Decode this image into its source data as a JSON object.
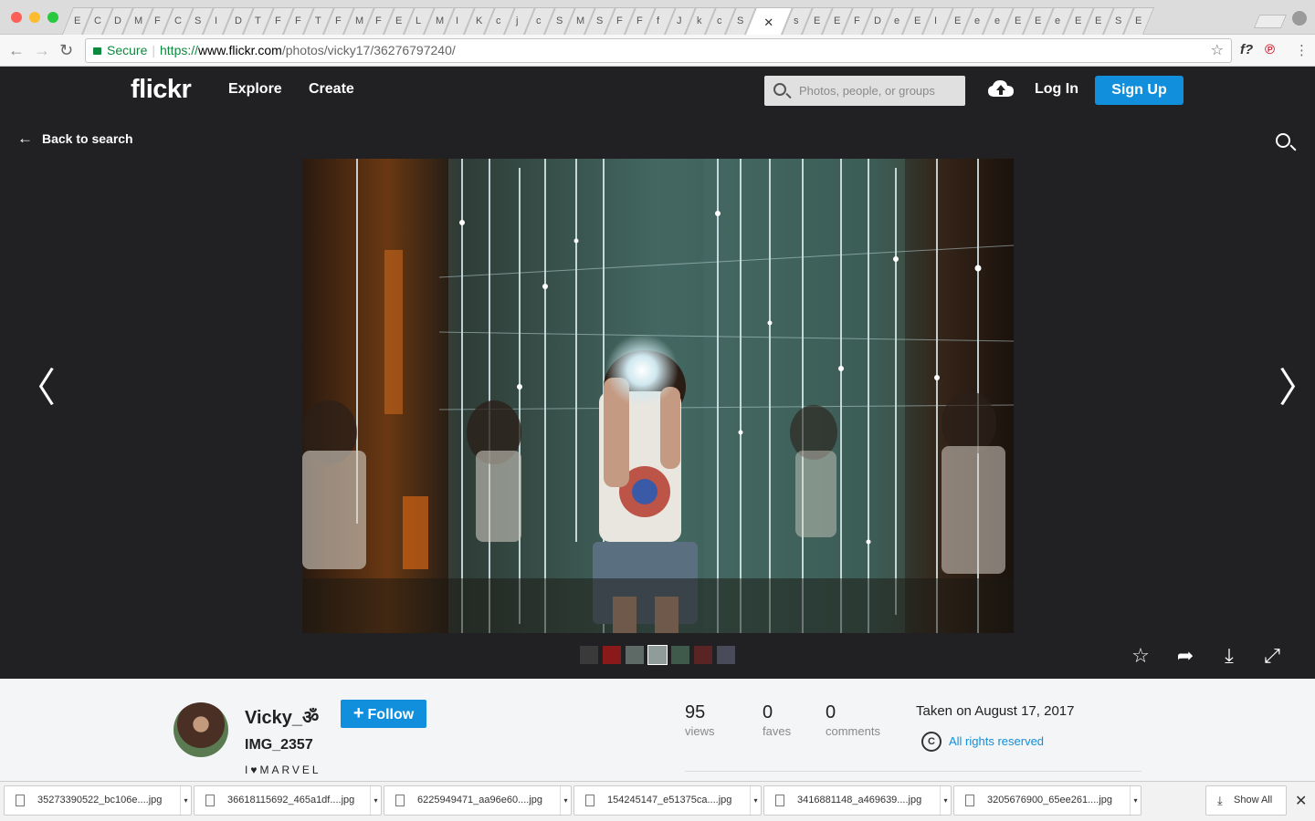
{
  "browser": {
    "tab_glyphs": [
      "E",
      "C",
      "D",
      "M",
      "F",
      "C",
      "S",
      "I",
      "D",
      "T",
      "F",
      "F",
      "T",
      "F",
      "M",
      "F",
      "E",
      "L",
      "M",
      "I",
      "K",
      "c",
      "j",
      "c",
      "S",
      "M",
      "S",
      "F",
      "F",
      "f",
      "J",
      "k",
      "c",
      "S"
    ],
    "active_tab_glyph": "✕",
    "tab_glyphs_after": [
      "s",
      "E",
      "E",
      "F",
      "D",
      "e",
      "E",
      "I",
      "E",
      "e",
      "e",
      "E",
      "E",
      "e",
      "E",
      "E",
      "S",
      "E"
    ],
    "secure_label": "Secure",
    "url_scheme": "https://",
    "url_host": "www.flickr.com",
    "url_path": "/photos/vicky17/36276797240/",
    "ext_icon_1": "f?",
    "ext_icon_2": "℗"
  },
  "flickr_header": {
    "logo": "flickr",
    "nav": [
      "Explore",
      "Create"
    ],
    "search_placeholder": "Photos, people, or groups",
    "login": "Log In",
    "signup": "Sign Up"
  },
  "viewer": {
    "back_label": "Back to search",
    "prev_arrow": "〈",
    "next_arrow": "〉",
    "thumb_colors": [
      "#3a3a3a",
      "#8a1a1a",
      "#5e6a66",
      "#8f9c9a",
      "#3f5a4a",
      "#5a2424",
      "#4a4b5a"
    ],
    "action_icons": [
      "favorite-icon",
      "share-icon",
      "download-icon",
      "fullscreen-icon"
    ],
    "action_glyphs": [
      "☆",
      "➦",
      "⤓",
      "⤢"
    ]
  },
  "photo_info": {
    "username": "Vicky_ॐ",
    "follow_label": "Follow",
    "follow_plus": "+",
    "title": "IMG_2357",
    "description": "I♥MARVEL",
    "stats": [
      {
        "value": "95",
        "label": "views"
      },
      {
        "value": "0",
        "label": "faves"
      },
      {
        "value": "0",
        "label": "comments"
      }
    ],
    "taken": "Taken on August 17, 2017",
    "license_icon": "C",
    "rights": "All rights reserved"
  },
  "downloads": {
    "items": [
      "35273390522_bc106e....jpg",
      "36618115692_465a1df....jpg",
      "6225949471_aa96e60....jpg",
      "154245147_e51375ca....jpg",
      "3416881148_a469639....jpg",
      "3205676900_65ee261....jpg"
    ],
    "caret": "▾",
    "show_all": "Show All",
    "show_all_icon": "⤓",
    "close": "✕"
  },
  "colors": {
    "flickr_dark": "#212124",
    "flickr_blue": "#128fdc",
    "secure_green": "#0b8a3e"
  }
}
